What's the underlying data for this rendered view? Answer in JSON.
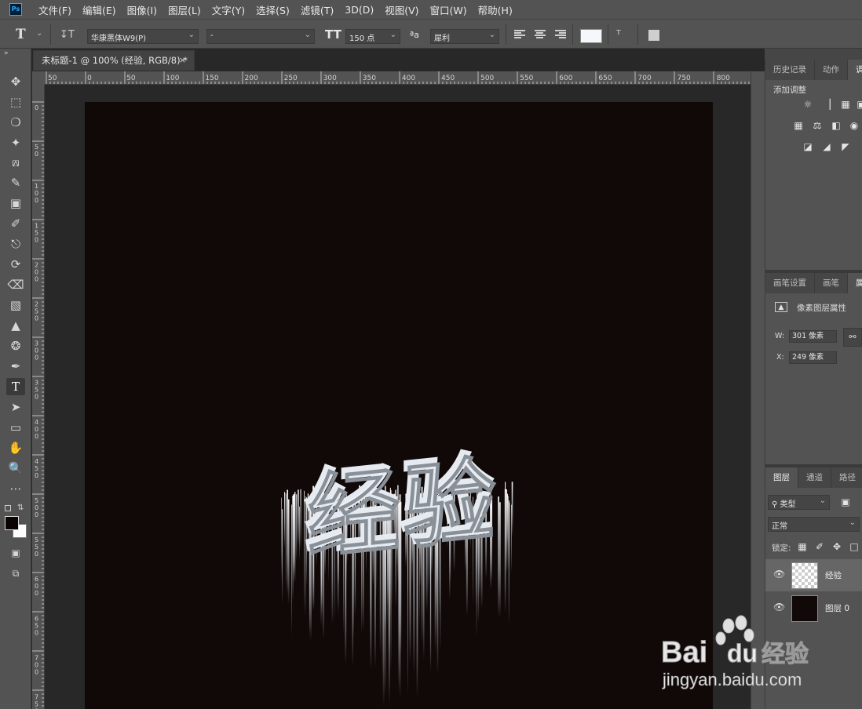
{
  "app": {
    "logo": "Ps"
  },
  "menu": [
    "文件(F)",
    "编辑(E)",
    "图像(I)",
    "图层(L)",
    "文字(Y)",
    "选择(S)",
    "滤镜(T)",
    "3D(D)",
    "视图(V)",
    "窗口(W)",
    "帮助(H)"
  ],
  "options": {
    "tool_preset": "T",
    "font_family": "华康黑体W9(P)",
    "font_style": "-",
    "font_size": "150 点",
    "antialias_icon": "ªa",
    "antialias": "犀利",
    "text_color": "#f5f7fb"
  },
  "document": {
    "tab_title": "未标题-1 @ 100% (经验, RGB/8) *",
    "close_label": "×",
    "canvas_color": "#100908",
    "text": "经验",
    "ruler_h_labels": [
      "50",
      "0",
      "50",
      "100",
      "150",
      "200",
      "250",
      "300",
      "350",
      "400",
      "450",
      "500",
      "550",
      "600",
      "650",
      "700",
      "750",
      "800"
    ],
    "ruler_v_labels": [
      "0",
      "5 0",
      "1 0 0",
      "1 5 0",
      "2 0 0",
      "2 5 0",
      "3 0 0",
      "3 5 0",
      "4 0 0",
      "4 5 0",
      "5 0 0",
      "5 5 0",
      "6 0 0",
      "6 5 0",
      "7 0 0",
      "7 5 0"
    ]
  },
  "tools": [
    "move-tool",
    "marquee-tool",
    "lasso-tool",
    "magic-wand-tool",
    "crop-tool",
    "eyedropper-tool",
    "healing-tool",
    "brush-tool",
    "stamp-tool",
    "history-brush-tool",
    "eraser-tool",
    "gradient-tool",
    "blur-tool",
    "dodge-tool",
    "pen-tool",
    "type-tool",
    "path-select-tool",
    "shape-tool",
    "hand-tool",
    "zoom-tool",
    "more-tools"
  ],
  "colors": {
    "foreground": "#0b0303",
    "background": "#ffffff"
  },
  "panels": {
    "top_tabs": [
      "历史记录",
      "动作",
      "调"
    ],
    "adjustments_title": "添加调整",
    "mid_tabs": [
      "画笔设置",
      "画笔",
      "属"
    ],
    "properties_title": "像素图层属性",
    "w_label": "W:",
    "w_value": "301 像素",
    "x_label": "X:",
    "x_value": "249 像素",
    "layers_tabs": [
      "图层",
      "通道",
      "路径"
    ],
    "filter_kind": "类型",
    "blend_mode": "正常",
    "lock_label": "锁定:",
    "layers": [
      {
        "name": "经验",
        "selected": true
      },
      {
        "name": "图层 0",
        "selected": false
      }
    ]
  },
  "watermark": {
    "brand": "Bai",
    "brand2": "du",
    "suffix": "经验",
    "url": "jingyan.baidu.com"
  }
}
